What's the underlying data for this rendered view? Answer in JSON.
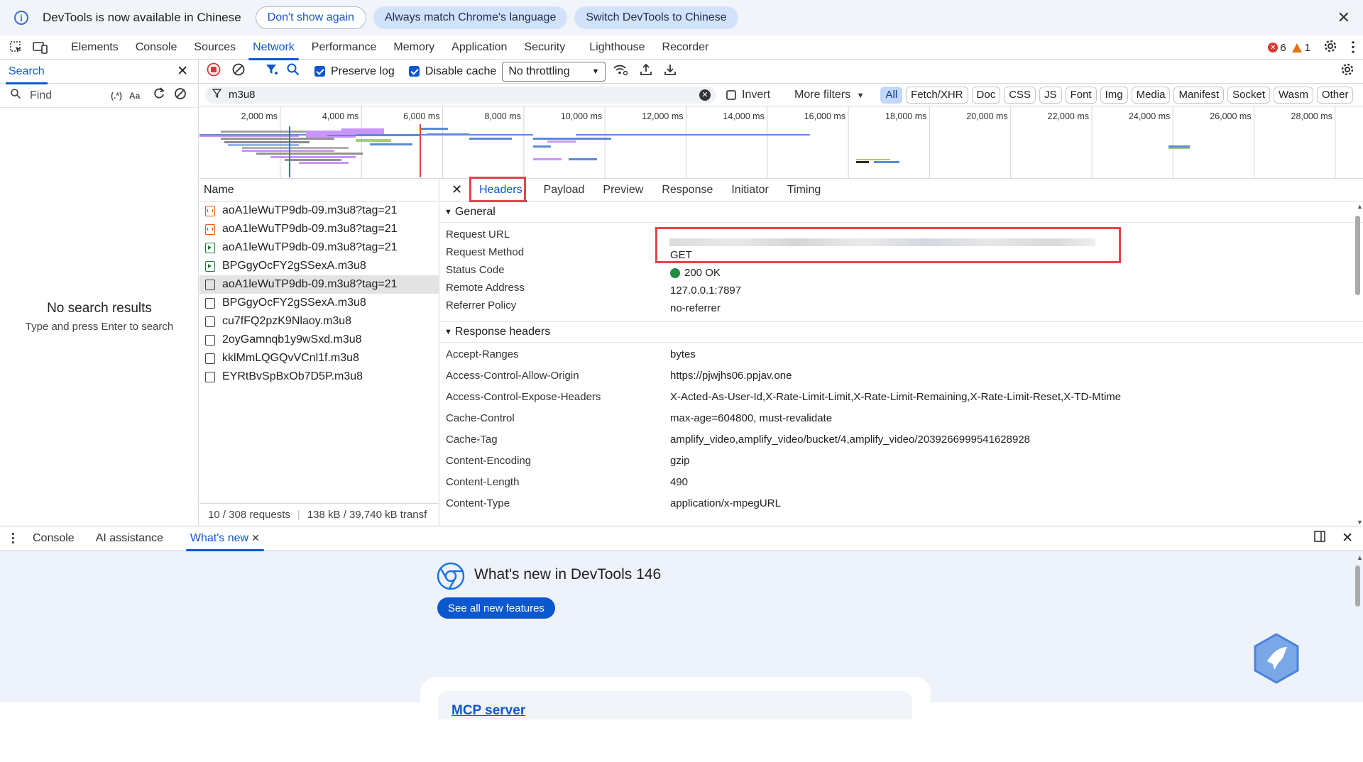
{
  "infobar": {
    "message": "DevTools is now available in Chinese",
    "btn_dont_show": "Don't show again",
    "btn_always_match": "Always match Chrome's language",
    "btn_switch": "Switch DevTools to Chinese"
  },
  "main_tabs": [
    "Elements",
    "Console",
    "Sources",
    "Network",
    "Performance",
    "Memory",
    "Application",
    "Security",
    "Lighthouse",
    "Recorder"
  ],
  "issues": {
    "errors": "6",
    "warnings": "1"
  },
  "search_panel": {
    "tab_label": "Search",
    "find_placeholder": "Find",
    "regex_label": "(.*)",
    "case_label": "Aa",
    "empty_title": "No search results",
    "empty_hint": "Type and press Enter to search"
  },
  "network_toolbar": {
    "preserve_log": "Preserve log",
    "disable_cache": "Disable cache",
    "throttling": "No throttling"
  },
  "filter": {
    "value": "m3u8",
    "invert": "Invert",
    "more_filters": "More filters",
    "types": [
      "All",
      "Fetch/XHR",
      "Doc",
      "CSS",
      "JS",
      "Font",
      "Img",
      "Media",
      "Manifest",
      "Socket",
      "Wasm",
      "Other"
    ]
  },
  "timeline_ticks": [
    "2,000 ms",
    "4,000 ms",
    "6,000 ms",
    "8,000 ms",
    "10,000 ms",
    "12,000 ms",
    "14,000 ms",
    "16,000 ms",
    "18,000 ms",
    "20,000 ms",
    "22,000 ms",
    "24,000 ms",
    "26,000 ms",
    "28,000 ms"
  ],
  "requests": {
    "column_name": "Name",
    "items": [
      {
        "name": "aoA1leWuTP9db-09.m3u8?tag=21",
        "type": "xhr"
      },
      {
        "name": "aoA1leWuTP9db-09.m3u8?tag=21",
        "type": "xhr"
      },
      {
        "name": "aoA1leWuTP9db-09.m3u8?tag=21",
        "type": "media"
      },
      {
        "name": "BPGgyOcFY2gSSexA.m3u8",
        "type": "media"
      },
      {
        "name": "aoA1leWuTP9db-09.m3u8?tag=21",
        "type": "doc"
      },
      {
        "name": "BPGgyOcFY2gSSexA.m3u8",
        "type": "doc"
      },
      {
        "name": "cu7fFQ2pzK9Nlaoy.m3u8",
        "type": "doc"
      },
      {
        "name": "2oyGamnqb1y9wSxd.m3u8",
        "type": "doc"
      },
      {
        "name": "kklMmLQGQvVCnl1f.m3u8",
        "type": "doc"
      },
      {
        "name": "EYRtBvSpBxOb7D5P.m3u8",
        "type": "doc"
      }
    ],
    "selected_index": 4,
    "status_count": "10 / 308 requests",
    "status_size": "138 kB / 39,740 kB transf"
  },
  "detail": {
    "tabs": [
      "Headers",
      "Payload",
      "Preview",
      "Response",
      "Initiator",
      "Timing"
    ],
    "general_title": "General",
    "general": [
      {
        "key": "Request URL",
        "value": ""
      },
      {
        "key": "Request Method",
        "value": "GET"
      },
      {
        "key": "Status Code",
        "value": "200 OK"
      },
      {
        "key": "Remote Address",
        "value": "127.0.0.1:7897"
      },
      {
        "key": "Referrer Policy",
        "value": "no-referrer"
      }
    ],
    "response_title": "Response headers",
    "response_headers": [
      {
        "key": "Accept-Ranges",
        "value": "bytes"
      },
      {
        "key": "Access-Control-Allow-Origin",
        "value": "https://pjwjhs06.ppjav.one"
      },
      {
        "key": "Access-Control-Expose-Headers",
        "value": "X-Acted-As-User-Id,X-Rate-Limit-Limit,X-Rate-Limit-Remaining,X-Rate-Limit-Reset,X-TD-Mtime"
      },
      {
        "key": "Cache-Control",
        "value": "max-age=604800, must-revalidate"
      },
      {
        "key": "Cache-Tag",
        "value": "amplify_video,amplify_video/bucket/4,amplify_video/2039266999541628928"
      },
      {
        "key": "Content-Encoding",
        "value": "gzip"
      },
      {
        "key": "Content-Length",
        "value": "490"
      },
      {
        "key": "Content-Type",
        "value": "application/x-mpegURL"
      }
    ]
  },
  "drawer": {
    "tabs": [
      "Console",
      "AI assistance",
      "What's new"
    ],
    "whats_new_title": "What's new in DevTools 146",
    "see_all": "See all new features",
    "card_link": "MCP server"
  },
  "colors": {
    "accent": "#0b57d0",
    "highlight_box": "#e5444b",
    "status_ok": "#1e8e3e",
    "error": "#dc362e",
    "warning": "#e37400"
  }
}
